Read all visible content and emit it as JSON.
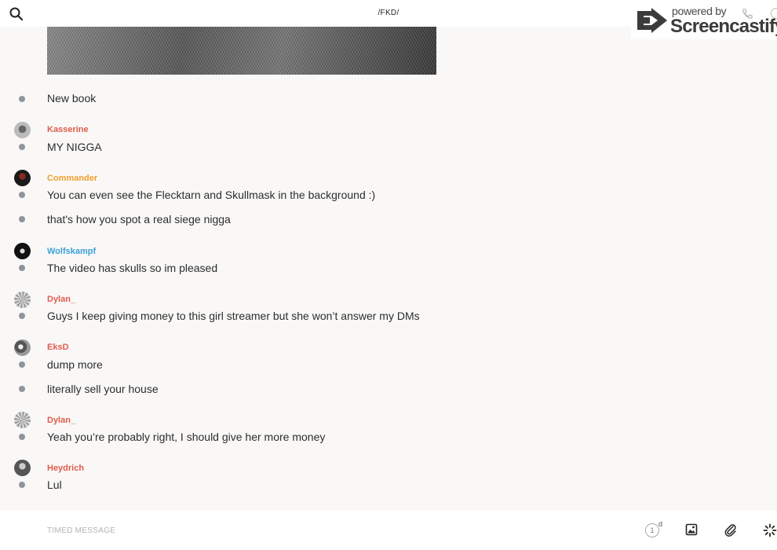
{
  "header": {
    "channel_title": "/FKD/",
    "search_icon": "search-icon",
    "phone_icon": "phone-icon",
    "info_icon": "info-icon"
  },
  "watermark": {
    "powered_text": "powered by",
    "brand_text": "Screencastify"
  },
  "feed": {
    "image_description_icon": "knit-fabric-image",
    "rows": [
      {
        "author": "",
        "text": "New book"
      },
      {
        "author": "Kasserine",
        "author_color": "#e05c4b",
        "text": "MY NIGGA"
      },
      {
        "author": "Commander",
        "author_color": "#f0a030",
        "text": "You can even see the Flecktarn and Skullmask in the background :)"
      },
      {
        "author": "",
        "text": "that's how you spot a real siege nigga"
      },
      {
        "author": "Wolfskampf",
        "author_color": "#3a9fd8",
        "text": "The video has skulls so im pleased"
      },
      {
        "author": "Dylan_",
        "author_color": "#e05c4b",
        "text": "Guys I keep giving money to this girl streamer but she won’t answer my DMs"
      },
      {
        "author": "EksD",
        "author_color": "#e05c4b",
        "text": "dump more"
      },
      {
        "author": "",
        "text": "literally sell your house"
      },
      {
        "author": "Dylan_",
        "author_color": "#e05c4b",
        "text": "Yeah you’re probably right, I should give her more money"
      },
      {
        "author": "Heydrich",
        "author_color": "#e05c4b",
        "text": "Lul"
      }
    ]
  },
  "composer": {
    "placeholder": "TIMED MESSAGE",
    "timer_value": "1",
    "timer_unit": "d",
    "image_icon": "image-icon",
    "attach_icon": "paperclip-icon",
    "loading_icon": "spinner-icon"
  }
}
